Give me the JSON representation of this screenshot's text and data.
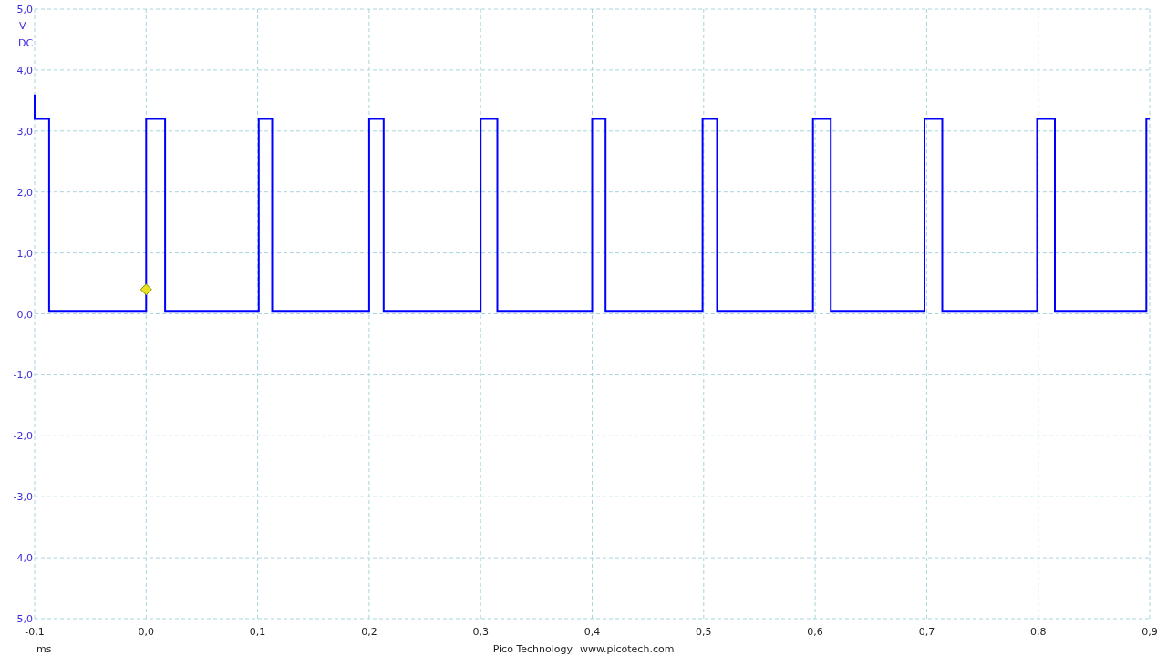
{
  "channel": {
    "coupling": "DC"
  },
  "trigger": {
    "visible": true
  },
  "chart_data": {
    "type": "line",
    "grid": true,
    "ylabel": "V",
    "xlabel": "ms",
    "xlim": [
      -0.1,
      0.9
    ],
    "ylim": [
      -5,
      5
    ],
    "xticks": [
      {
        "value": -0.1,
        "label": "-0,1"
      },
      {
        "value": 0,
        "label": "0,0"
      },
      {
        "value": 0.1,
        "label": "0,1"
      },
      {
        "value": 0.2,
        "label": "0,2"
      },
      {
        "value": 0.3,
        "label": "0,3"
      },
      {
        "value": 0.4,
        "label": "0,4"
      },
      {
        "value": 0.5,
        "label": "0,5"
      },
      {
        "value": 0.6,
        "label": "0,6"
      },
      {
        "value": 0.7,
        "label": "0,7"
      },
      {
        "value": 0.8,
        "label": "0,8"
      },
      {
        "value": 0.9,
        "label": "0,9"
      }
    ],
    "yticks": [
      {
        "value": 5,
        "label": "5,0"
      },
      {
        "value": 4,
        "label": "4,0"
      },
      {
        "value": 3,
        "label": "3,0"
      },
      {
        "value": 2,
        "label": "2,0"
      },
      {
        "value": 1,
        "label": "1,0"
      },
      {
        "value": 0,
        "label": "0,0"
      },
      {
        "value": -1,
        "label": "-1,0"
      },
      {
        "value": -2,
        "label": "-2,0"
      },
      {
        "value": -3,
        "label": "-3,0"
      },
      {
        "value": -4,
        "label": "-4,0"
      },
      {
        "value": -5,
        "label": "-5,0"
      }
    ],
    "x": [
      -0.1,
      -0.1,
      -0.087,
      -0.087,
      0.0,
      0.0,
      0.017,
      0.017,
      0.101,
      0.101,
      0.113,
      0.113,
      0.2,
      0.2,
      0.213,
      0.213,
      0.3,
      0.3,
      0.315,
      0.315,
      0.4,
      0.4,
      0.412,
      0.412,
      0.499,
      0.499,
      0.512,
      0.512,
      0.598,
      0.598,
      0.614,
      0.614,
      0.698,
      0.698,
      0.714,
      0.714,
      0.799,
      0.799,
      0.815,
      0.815,
      0.897,
      0.897,
      0.9
    ],
    "series": [
      {
        "color": "#0000ff",
        "values": [
          3.6,
          3.2,
          3.2,
          0.05,
          0.05,
          3.2,
          3.2,
          0.05,
          0.05,
          3.2,
          3.2,
          0.05,
          0.05,
          3.2,
          3.2,
          0.05,
          0.05,
          3.2,
          3.2,
          0.05,
          0.05,
          3.2,
          3.2,
          0.05,
          0.05,
          3.2,
          3.2,
          0.05,
          0.05,
          3.2,
          3.2,
          0.05,
          0.05,
          3.2,
          3.2,
          0.05,
          0.05,
          3.2,
          3.2,
          0.05,
          0.05,
          3.2,
          3.2
        ]
      }
    ]
  },
  "footer": {
    "company": "Pico Technology",
    "website": "www.picotech.com"
  }
}
